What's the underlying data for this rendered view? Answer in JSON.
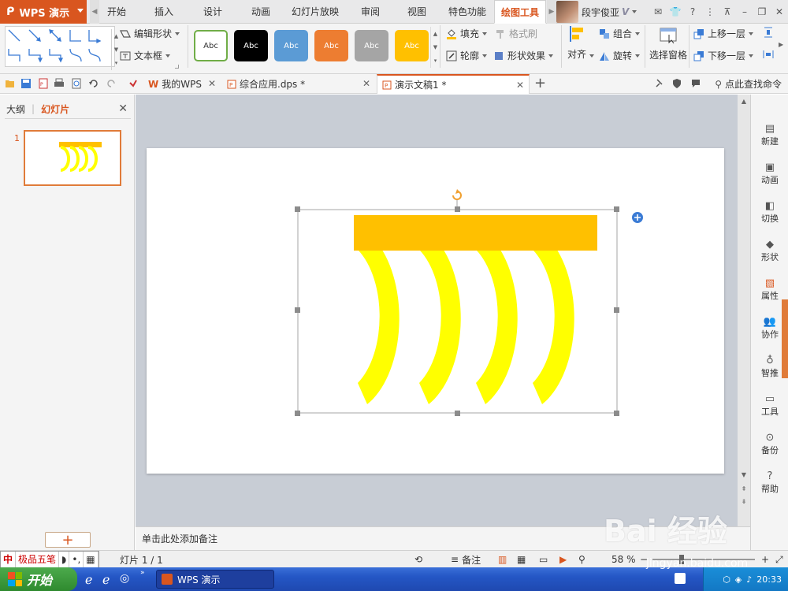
{
  "app": {
    "logo_text": "WPS 演示"
  },
  "menu": {
    "tabs": [
      "开始",
      "插入",
      "设计",
      "动画",
      "幻灯片放映",
      "审阅",
      "视图",
      "特色功能",
      "绘图工具"
    ],
    "active_tab": "绘图工具"
  },
  "user": {
    "name": "段宇俊亚",
    "vip": "V"
  },
  "ribbon": {
    "edit_shape": "编辑形状",
    "text_box": "文本框",
    "style_swatches": [
      {
        "label": "Abc",
        "bg": "#ffffff",
        "fg": "#333333",
        "border": "#70ad47"
      },
      {
        "label": "Abc",
        "bg": "#000000",
        "fg": "#ffffff",
        "border": "#000000"
      },
      {
        "label": "Abc",
        "bg": "#5b9bd5",
        "fg": "#ffffff",
        "border": "#5b9bd5"
      },
      {
        "label": "Abc",
        "bg": "#ed7d31",
        "fg": "#ffffff",
        "border": "#ed7d31"
      },
      {
        "label": "Abc",
        "bg": "#a5a5a5",
        "fg": "#ffffff",
        "border": "#a5a5a5"
      },
      {
        "label": "Abc",
        "bg": "#ffc000",
        "fg": "#ffffff",
        "border": "#ffc000"
      }
    ],
    "fill": "填充",
    "format_painter": "格式刷",
    "outline": "轮廓",
    "shape_effects": "形状效果",
    "align": "对齐",
    "group": "组合",
    "rotate": "旋转",
    "selection_pane": "选择窗格",
    "bring_forward": "上移一层",
    "send_backward": "下移一层"
  },
  "quickbar": {
    "doc_tabs": [
      {
        "label": "我的WPS"
      },
      {
        "label": "综合应用.dps *"
      },
      {
        "label": "演示文稿1 *"
      }
    ],
    "find_command": "点此查找命令"
  },
  "left_panel": {
    "outline_tab": "大纲",
    "slides_tab": "幻灯片",
    "slide_number": "1"
  },
  "notes": {
    "placeholder": "单击此处添加备注"
  },
  "right_bar": {
    "items": [
      "新建",
      "动画",
      "切换",
      "形状",
      "属性",
      "协作",
      "智推",
      "工具",
      "备份",
      "帮助"
    ]
  },
  "status": {
    "ime_label": "极品五笔",
    "slide_info": "灯片 1 / 1",
    "notes_btn": "备注",
    "zoom": "58 %"
  },
  "taskbar": {
    "start": "开始",
    "wps_task": "WPS 演示",
    "clock": "20:33"
  },
  "watermark": {
    "text": "Bai 经验",
    "sub": "jingyan.baidu.com"
  },
  "colors": {
    "accent": "#d9561f",
    "bar_fill": "#ffc000",
    "arc_fill": "#ffff00"
  }
}
